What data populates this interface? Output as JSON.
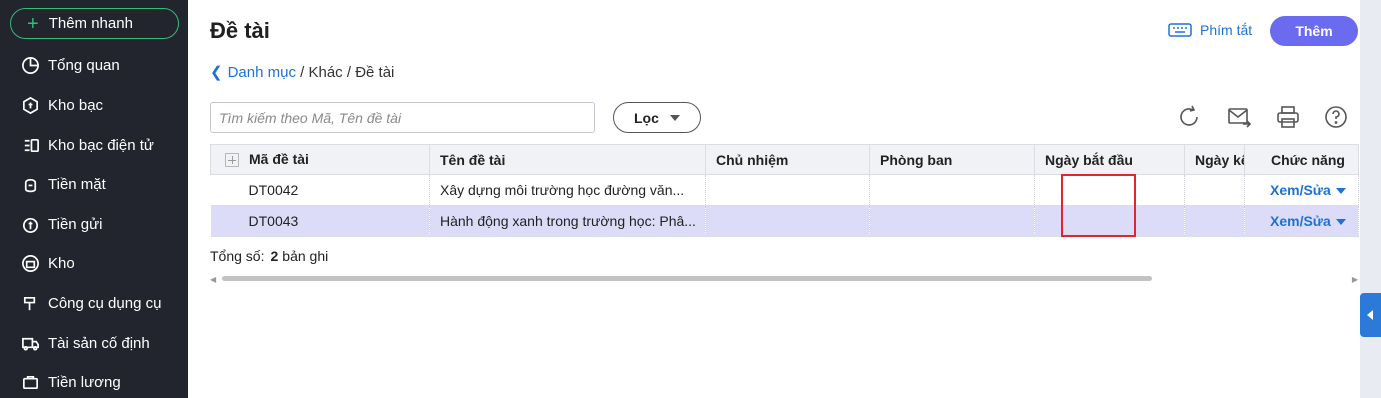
{
  "sidebar": {
    "quick_add_label": "Thêm nhanh",
    "items": [
      {
        "label": "Tổng quan",
        "icon": "pie-chart-icon"
      },
      {
        "label": "Kho bạc",
        "icon": "treasury-icon"
      },
      {
        "label": "Kho bạc điện tử",
        "icon": "e-treasury-icon"
      },
      {
        "label": "Tiền mặt",
        "icon": "cash-icon"
      },
      {
        "label": "Tiền gửi",
        "icon": "deposit-icon"
      },
      {
        "label": "Kho",
        "icon": "warehouse-icon"
      },
      {
        "label": "Công cụ dụng cụ",
        "icon": "tools-icon"
      },
      {
        "label": "Tài sản cố định",
        "icon": "truck-icon"
      },
      {
        "label": "Tiền lương",
        "icon": "salary-icon"
      }
    ]
  },
  "header": {
    "title": "Đề tài",
    "shortcut_label": "Phím tắt",
    "add_label": "Thêm",
    "breadcrumb": {
      "root": "Danh mục",
      "sep1": " / ",
      "mid": "Khác",
      "sep2": " / ",
      "current": "Đề tài"
    }
  },
  "toolbar": {
    "search_placeholder": "Tìm kiếm theo Mã, Tên đề tài",
    "filter_label": "Lọc"
  },
  "table": {
    "columns": [
      "Mã đề tài",
      "Tên đề tài",
      "Chủ nhiệm",
      "Phòng ban",
      "Ngày bắt đầu",
      "Ngày kế",
      "Chức năng"
    ],
    "rows": [
      {
        "code": "DT0042",
        "name": "Xây dựng môi trường học đường văn...",
        "lead": "",
        "dept": "",
        "start": "",
        "end": "",
        "action": "Xem/Sửa"
      },
      {
        "code": "DT0043",
        "name": "Hành động xanh trong trường học: Phâ...",
        "lead": "",
        "dept": "",
        "start": "",
        "end": "",
        "action": "Xem/Sửa"
      }
    ]
  },
  "footer": {
    "total_label": "Tổng số:",
    "total_count": "2",
    "total_unit": "bản ghi"
  },
  "colors": {
    "accent": "#6b6bf0",
    "link": "#1e72d6",
    "sidebar_bg": "#22252e",
    "highlight": "#e0252e"
  }
}
